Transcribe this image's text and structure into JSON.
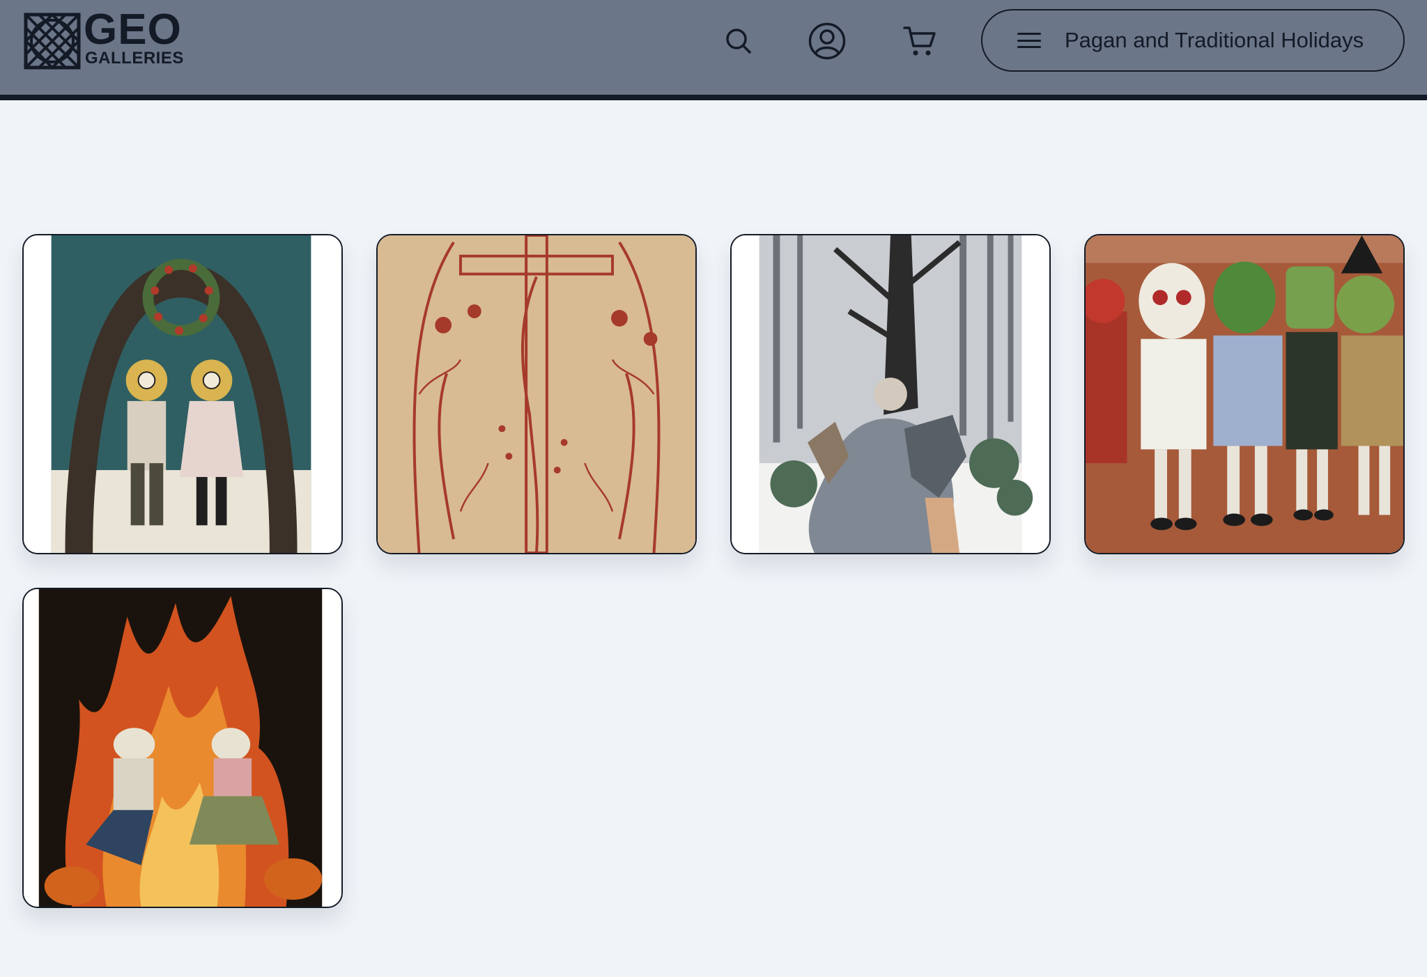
{
  "header": {
    "logo": {
      "title": "GEO",
      "subtitle": "GALLERIES"
    },
    "icons": {
      "search": "search-icon",
      "account": "account-circle-icon",
      "cart": "shopping-cart-icon",
      "menu": "hamburger-menu-icon"
    },
    "menu_label": "Pagan and Traditional Holidays"
  },
  "colors": {
    "header_bg": "#6b7689",
    "header_border": "#141a26",
    "page_bg": "#f0f4f8",
    "ink": "#141a26"
  },
  "gallery": {
    "items": [
      {
        "id": "artwork-1"
      },
      {
        "id": "artwork-2"
      },
      {
        "id": "artwork-3"
      },
      {
        "id": "artwork-4"
      },
      {
        "id": "artwork-5"
      }
    ]
  }
}
